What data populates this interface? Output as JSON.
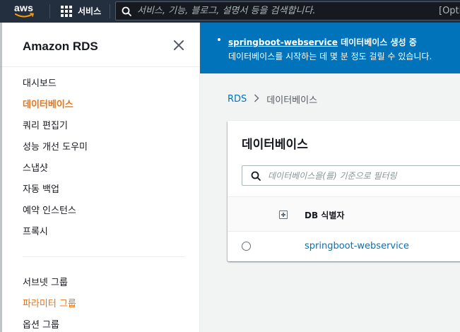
{
  "topnav": {
    "logo_text": "aws",
    "services_label": "서비스",
    "search_placeholder": "서비스, 기능, 블로그, 설명서 등을 검색합니다.",
    "search_hint": "[Opti"
  },
  "sidebar": {
    "title": "Amazon RDS",
    "items": [
      {
        "label": "대시보드"
      },
      {
        "label": "데이터베이스"
      },
      {
        "label": "쿼리 편집기"
      },
      {
        "label": "성능 개선 도우미"
      },
      {
        "label": "스냅샷"
      },
      {
        "label": "자동 백업"
      },
      {
        "label": "예약 인스턴스"
      },
      {
        "label": "프록시"
      }
    ],
    "items2": [
      {
        "label": "서브넷 그룹"
      },
      {
        "label": "파라미터 그룹"
      },
      {
        "label": "옵션 그룹"
      }
    ]
  },
  "flash": {
    "link_text": "springboot-webservice",
    "status_text": " 데이터베이스 생성 중",
    "message": "데이터베이스를 시작하는 데 몇 분 정도 걸릴 수 있습니다."
  },
  "breadcrumb": {
    "root": "RDS",
    "current": "데이터베이스"
  },
  "panel": {
    "title": "데이터베이스",
    "filter_placeholder": "데이터베이스을(를) 기준으로 필터링",
    "column_db_id": "DB 식별자",
    "rows": [
      {
        "db_id": "springboot-webservice"
      }
    ]
  },
  "colors": {
    "nav_bg": "#232f3e",
    "accent_orange": "#ec7211",
    "link_blue": "#0073bb",
    "flash_bg": "#0073bb"
  }
}
